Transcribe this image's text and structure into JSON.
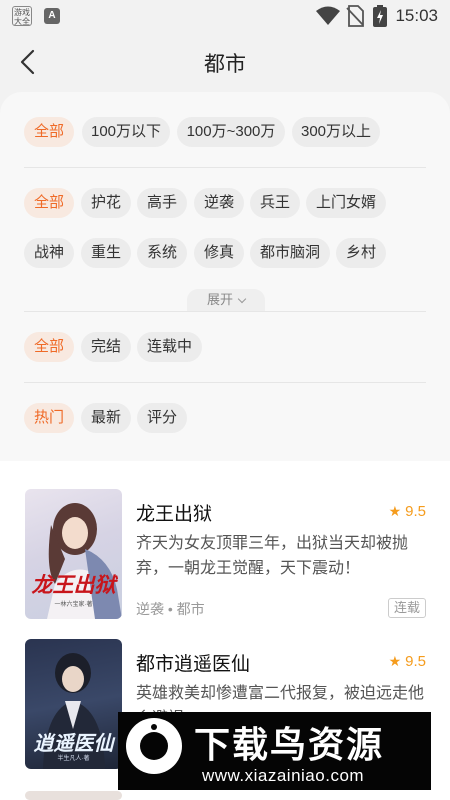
{
  "status_bar": {
    "app_badge_1": "游戏大全",
    "app_badge_2": "A",
    "time": "15:03"
  },
  "nav": {
    "title": "都市"
  },
  "filters": {
    "word_count": [
      "全部",
      "100万以下",
      "100万~300万",
      "300万以上"
    ],
    "category": [
      "全部",
      "护花",
      "高手",
      "逆袭",
      "兵王",
      "上门女婿",
      "战神",
      "重生",
      "系统",
      "修真",
      "都市脑洞",
      "乡村"
    ],
    "expand_label": "展开",
    "status": [
      "全部",
      "完结",
      "连载中"
    ],
    "sort": [
      "热门",
      "最新",
      "评分"
    ]
  },
  "books": [
    {
      "title": "龙王出狱",
      "rating": "9.5",
      "description": "齐天为女友顶罪三年，出狱当天却被抛弃，一朝龙王觉醒，天下震动！",
      "tags": "逆袭 • 都市",
      "status": "连载",
      "cover_title": "龙王出狱",
      "cover_author": "一林六宝家·著"
    },
    {
      "title": "都市逍遥医仙",
      "rating": "9.5",
      "description": "英雄救美却惨遭富二代报复，被迫远走他乡避祸",
      "cover_title": "逍遥医仙",
      "cover_author": "半生凡人·著"
    }
  ],
  "watermark": {
    "text": "下载鸟资源",
    "url": "www.xiazainiao.com"
  },
  "colors": {
    "accent": "#ef6a27",
    "rating": "#f59c1d",
    "active_chip_bg": "#f8e9e0"
  }
}
